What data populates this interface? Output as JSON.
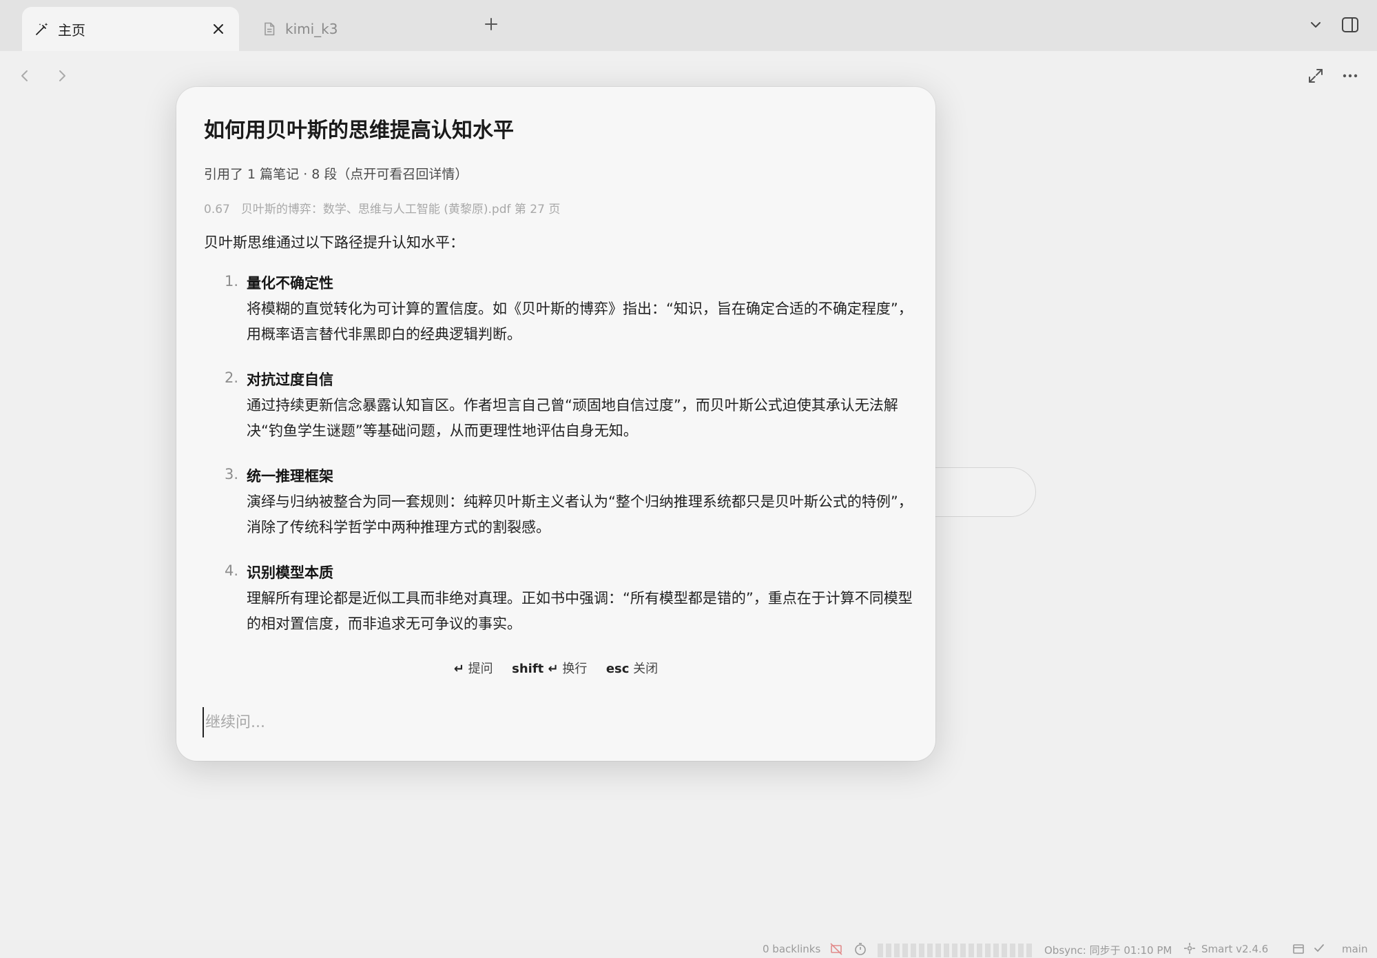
{
  "tabs": [
    {
      "label": "主页",
      "icon": "magic-wand-icon",
      "active": true
    },
    {
      "label": "kimi_k3",
      "icon": "file-icon",
      "active": false
    }
  ],
  "dialog": {
    "title": "如何用贝叶斯的思维提高认知水平",
    "subtitle": "引用了 1 篇笔记 · 8 段（点开可看召回详情）",
    "reference": {
      "score": "0.67",
      "source": "贝叶斯的博弈：数学、思维与人工智能 (黄黎原).pdf 第 27 页"
    },
    "intro": "贝叶斯思维通过以下路径提升认知水平：",
    "items": [
      {
        "num": "1.",
        "title": "量化不确定性",
        "body": "将模糊的直觉转化为可计算的置信度。如《贝叶斯的博弈》指出：“知识，旨在确定合适的不确定程度”，用概率语言替代非黑即白的经典逻辑判断。"
      },
      {
        "num": "2.",
        "title": "对抗过度自信",
        "body": "通过持续更新信念暴露认知盲区。作者坦言自己曾“顽固地自信过度”，而贝叶斯公式迫使其承认无法解决“钓鱼学生谜题”等基础问题，从而更理性地评估自身无知。"
      },
      {
        "num": "3.",
        "title": "统一推理框架",
        "body": "演绎与归纳被整合为同一套规则：纯粹贝叶斯主义者认为“整个归纳推理系统都只是贝叶斯公式的特例”，消除了传统科学哲学中两种推理方式的割裂感。"
      },
      {
        "num": "4.",
        "title": "识别模型本质",
        "body": "理解所有理论都是近似工具而非绝对真理。正如书中强调：“所有模型都是错的”，重点在于计算不同模型的相对置信度，而非追求无可争议的事实。"
      }
    ],
    "hints": {
      "enter_key": "↵",
      "enter_label": "提问",
      "shift_key": "shift ↵",
      "shift_label": "换行",
      "esc_key": "esc",
      "esc_label": "关闭"
    },
    "input_placeholder": "继续问..."
  },
  "statusbar": {
    "backlinks": "0 backlinks",
    "obsync": "Obsync: 同步于 01:10 PM",
    "smart": "Smart v2.4.6",
    "branch": "main"
  }
}
